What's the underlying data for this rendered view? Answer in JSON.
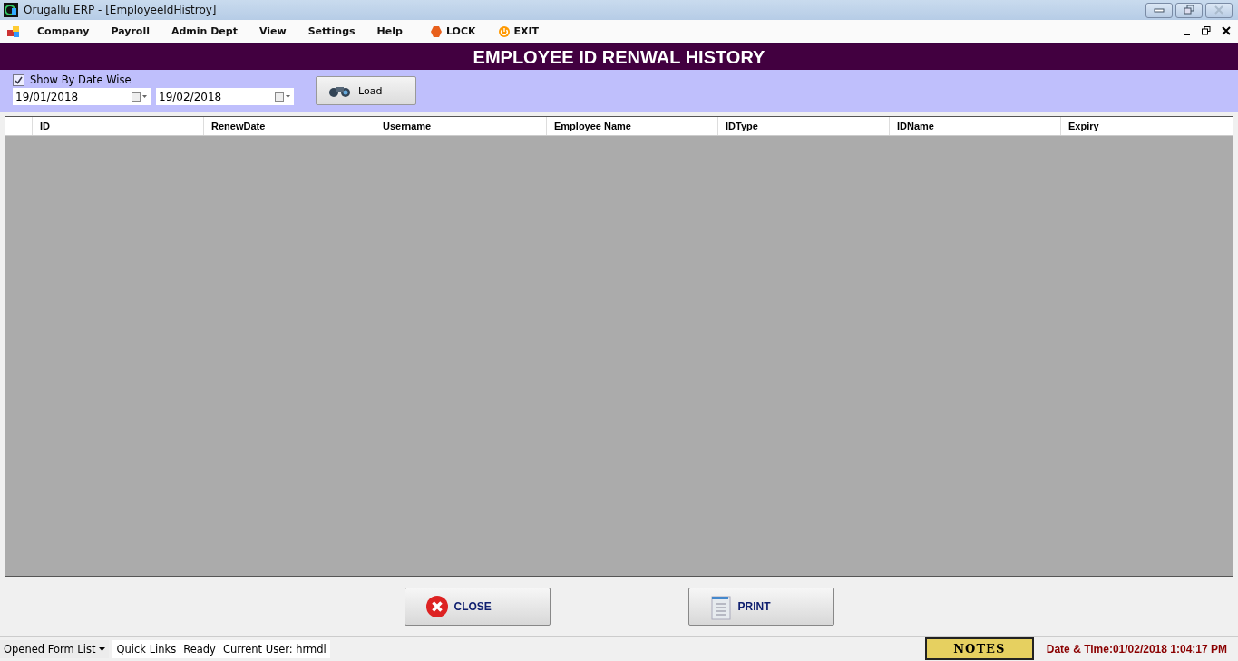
{
  "window": {
    "title": "Orugallu ERP - [EmployeeIdHistroy]"
  },
  "menu": [
    "Company",
    "Payroll",
    "Admin Dept",
    "View",
    "Settings",
    "Help"
  ],
  "menu_actions": [
    {
      "label": "LOCK",
      "kind": "lock"
    },
    {
      "label": "EXIT",
      "kind": "exit"
    }
  ],
  "form_title": "EMPLOYEE ID RENWAL HISTORY",
  "filter": {
    "show_by_date": {
      "label": "Show By Date Wise",
      "checked": true
    },
    "from_date": "19/01/2018",
    "to_date": "19/02/2018",
    "load_button": "Load"
  },
  "table": {
    "columns": [
      "ID",
      "RenewDate",
      "Username",
      "Employee Name",
      "IDType",
      "IDName",
      "Expiry"
    ]
  },
  "buttons": [
    {
      "label": "CLOSE",
      "kind": "close"
    },
    {
      "label": "PRINT",
      "kind": "print"
    }
  ],
  "status_bar": {
    "opened_forms": "Opened Form List",
    "quick_links": "Quick Links",
    "status": "Ready",
    "user": "Current User: hrmdl",
    "notes": "NOTES",
    "datetime": "Date & Time:01/02/2018 1:04:17 PM"
  }
}
